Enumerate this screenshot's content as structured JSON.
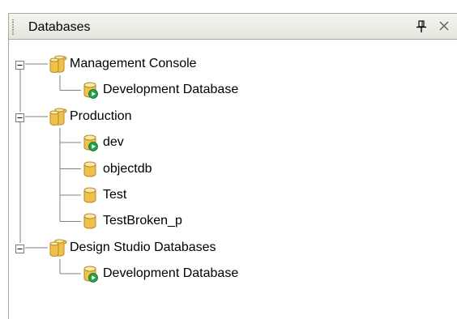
{
  "panel": {
    "title": "Databases",
    "icons": {
      "pin": "pin-icon",
      "close": "close-icon"
    }
  },
  "tree": {
    "groups": [
      {
        "label": "Management Console",
        "icon": "folder-database-icon",
        "expanded": true,
        "children": [
          {
            "label": "Development Database",
            "icon": "database-running-icon"
          }
        ]
      },
      {
        "label": "Production",
        "icon": "folder-database-icon",
        "expanded": true,
        "children": [
          {
            "label": "dev",
            "icon": "database-running-icon"
          },
          {
            "label": "objectdb",
            "icon": "database-icon"
          },
          {
            "label": "Test",
            "icon": "database-icon"
          },
          {
            "label": "TestBroken_p",
            "icon": "database-icon"
          }
        ]
      },
      {
        "label": "Design Studio Databases",
        "icon": "folder-database-icon",
        "expanded": true,
        "children": [
          {
            "label": "Development Database",
            "icon": "database-running-icon"
          }
        ]
      }
    ]
  },
  "colors": {
    "db_gold": "#f0c24a",
    "db_gold_light": "#fbe9a8",
    "db_outline": "#b08a2a",
    "running_green": "#22a04a",
    "tree_line": "#808080"
  }
}
